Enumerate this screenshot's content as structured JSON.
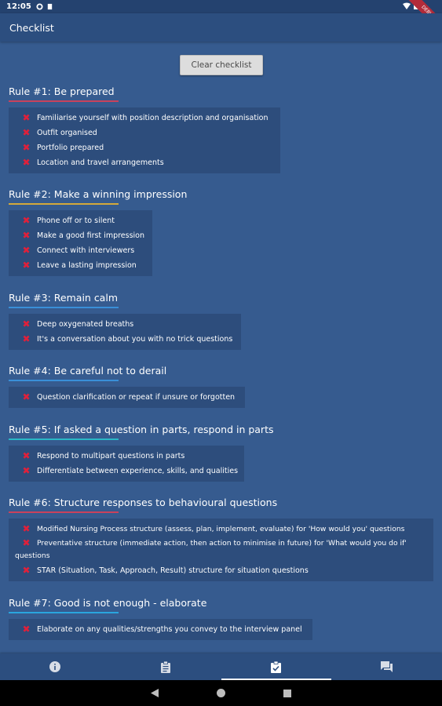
{
  "status_bar": {
    "time": "12:05",
    "ribbon": "DEBUG"
  },
  "app_bar": {
    "title": "Checklist"
  },
  "clear_button": "Clear checklist",
  "colors": {
    "background": "#365b8f",
    "appbar": "#2c4e7f",
    "box": "#2d4d7c",
    "x_icon": "#e0203a",
    "underlines": [
      "#c9425c",
      "#d4a93a",
      "#3a8fd8",
      "#3a8fd8",
      "#2ab7c6",
      "#c9425c",
      "#2aa5df"
    ]
  },
  "rules": [
    {
      "title": "Rule #1: Be prepared",
      "items": [
        "Familiarise yourself with position description and organisation",
        "Outfit organised",
        "Portfolio prepared",
        "Location and travel arrangements"
      ]
    },
    {
      "title": "Rule #2: Make a winning impression",
      "items": [
        "Phone off or to silent",
        "Make a good first impression",
        "Connect with interviewers",
        "Leave a lasting impression"
      ]
    },
    {
      "title": "Rule #3: Remain calm",
      "items": [
        "Deep oxygenated breaths",
        "It's a conversation about you with no trick questions"
      ]
    },
    {
      "title": "Rule #4: Be careful not to derail",
      "items": [
        "Question clarification or repeat if unsure or forgotten"
      ]
    },
    {
      "title": "Rule #5: If asked a question in parts, respond in parts",
      "items": [
        "Respond to multipart questions in parts",
        "Differentiate between experience, skills, and qualities"
      ]
    },
    {
      "title": "Rule #6: Structure responses to behavioural questions",
      "items": [
        "Modified Nursing Process structure (assess, plan, implement, evaluate) for 'How would you' questions",
        "Preventative structure (immediate action, then action to minimise in future) for 'What would you do if' questions",
        "STAR (Situation, Task, Approach, Result) structure for situation questions"
      ]
    },
    {
      "title": "Rule #7: Good is not enough - elaborate",
      "items": [
        "Elaborate on any qualities/strengths you convey to the interview panel"
      ]
    }
  ],
  "bottom_nav": [
    {
      "icon": "info-icon",
      "active": false
    },
    {
      "icon": "clipboard-icon",
      "active": false
    },
    {
      "icon": "clipboard-check-icon",
      "active": true
    },
    {
      "icon": "chat-icon",
      "active": false
    }
  ]
}
